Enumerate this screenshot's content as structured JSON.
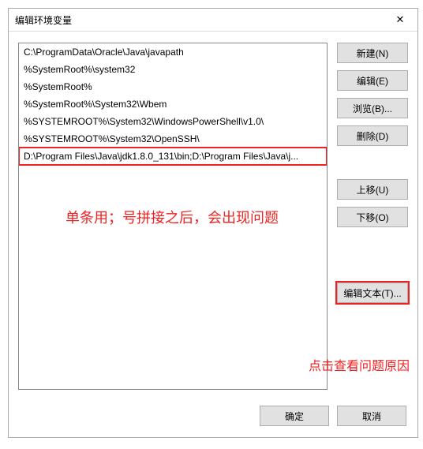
{
  "dialog": {
    "title": "编辑环境变量"
  },
  "list": {
    "items": [
      "C:\\ProgramData\\Oracle\\Java\\javapath",
      "%SystemRoot%\\system32",
      "%SystemRoot%",
      "%SystemRoot%\\System32\\Wbem",
      "%SYSTEMROOT%\\System32\\WindowsPowerShell\\v1.0\\",
      "%SYSTEMROOT%\\System32\\OpenSSH\\",
      "D:\\Program Files\\Java\\jdk1.8.0_131\\bin;D:\\Program Files\\Java\\j..."
    ],
    "selected_index": 6
  },
  "buttons": {
    "new": "新建(N)",
    "edit": "编辑(E)",
    "browse": "浏览(B)...",
    "delete": "删除(D)",
    "moveup": "上移(U)",
    "movedown": "下移(O)",
    "edittext": "编辑文本(T)...",
    "ok": "确定",
    "cancel": "取消"
  },
  "annotations": {
    "line1": "单条用；号拼接之后，会出现问题",
    "line2": "点击查看问题原因"
  }
}
